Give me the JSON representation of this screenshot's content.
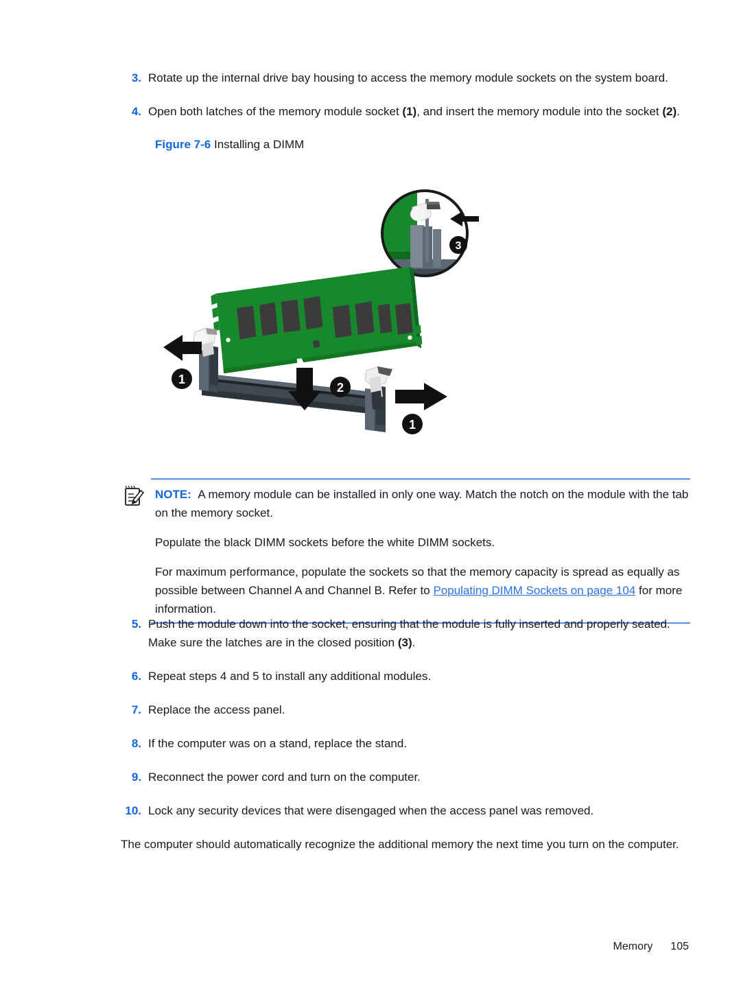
{
  "page": {
    "footer_section": "Memory",
    "footer_page_number": "105"
  },
  "steps_before_figure": [
    {
      "number": "3.",
      "text": "Rotate up the internal drive bay housing to access the memory module sockets on the system board."
    },
    {
      "number": "4.",
      "text_part1": "Open both latches of the memory module socket ",
      "callout1": "(1)",
      "text_part2": ", and insert the memory module into the socket ",
      "callout2": "(2)",
      "text_part3": "."
    }
  ],
  "figure": {
    "label": "Figure 7-6",
    "title": "Installing a DIMM",
    "callouts": [
      "1",
      "2",
      "3",
      "1"
    ],
    "colors": {
      "pcb_green": "#17882b",
      "pcb_green_dark": "#0e6a1e",
      "chip_dark": "#3b3b3b",
      "socket_slate": "#414a52",
      "socket_slate_dark": "#2c343a",
      "socket_slate_light": "#5b6772",
      "latch_white": "#e8e8e8",
      "arrow_black": "#111111",
      "callout_black": "#111111"
    }
  },
  "note": {
    "lead": "NOTE:",
    "icon": "note-pad-pencil-icon",
    "body": "A memory module can be installed in only one way. Match the notch on the module with the tab on the memory socket.",
    "paragraph2": "Populate the black DIMM sockets before the white DIMM sockets.",
    "paragraph3_part1": "For maximum performance, populate the sockets so that the memory capacity is spread as equally as possible between Channel A and Channel B. Refer to ",
    "paragraph3_link": "Populating DIMM Sockets on page 104",
    "paragraph3_part2": " for more information."
  },
  "steps_after_figure": [
    {
      "number": "5.",
      "text_part1": "Push the module down into the socket, ensuring that the module is fully inserted and properly seated. Make sure the latches are in the closed position ",
      "callout": "(3)",
      "text_part2": "."
    },
    {
      "number": "6.",
      "text": "Repeat steps 4 and 5 to install any additional modules."
    },
    {
      "number": "7.",
      "text": "Replace the access panel."
    },
    {
      "number": "8.",
      "text": "If the computer was on a stand, replace the stand."
    },
    {
      "number": "9.",
      "text": "Reconnect the power cord and turn on the computer."
    },
    {
      "number": "10.",
      "text": "Lock any security devices that were disengaged when the access panel was removed."
    }
  ],
  "closing_paragraph": "The computer should automatically recognize the additional memory the next time you turn on the computer."
}
